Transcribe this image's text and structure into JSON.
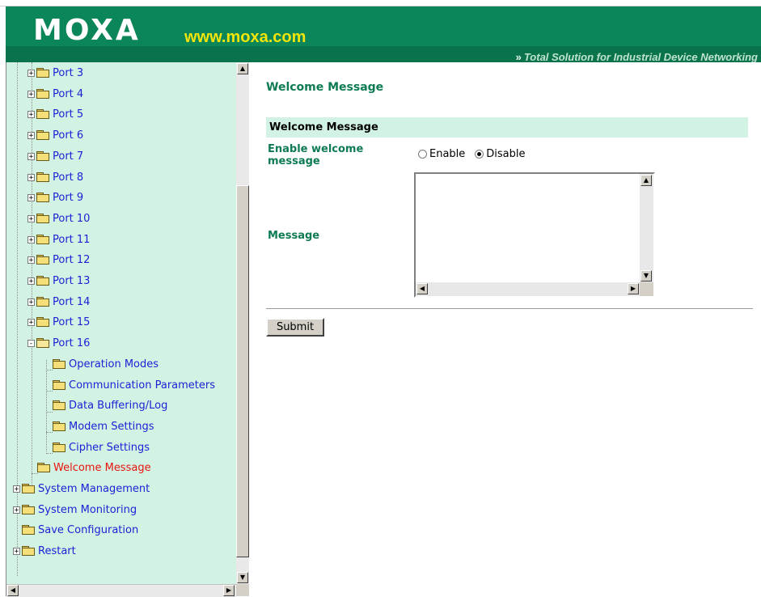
{
  "header": {
    "logo": "MOXA",
    "site": "www.moxa.com",
    "tagline": "Total Solution for Industrial Device Networking",
    "tagline_arrow": "»"
  },
  "sidebar": {
    "items": [
      {
        "label": "Port 3",
        "level": 1,
        "expand": "+",
        "current": false
      },
      {
        "label": "Port 4",
        "level": 1,
        "expand": "+",
        "current": false
      },
      {
        "label": "Port 5",
        "level": 1,
        "expand": "+",
        "current": false
      },
      {
        "label": "Port 6",
        "level": 1,
        "expand": "+",
        "current": false
      },
      {
        "label": "Port 7",
        "level": 1,
        "expand": "+",
        "current": false
      },
      {
        "label": "Port 8",
        "level": 1,
        "expand": "+",
        "current": false
      },
      {
        "label": "Port 9",
        "level": 1,
        "expand": "+",
        "current": false
      },
      {
        "label": "Port 10",
        "level": 1,
        "expand": "+",
        "current": false
      },
      {
        "label": "Port 11",
        "level": 1,
        "expand": "+",
        "current": false
      },
      {
        "label": "Port 12",
        "level": 1,
        "expand": "+",
        "current": false
      },
      {
        "label": "Port 13",
        "level": 1,
        "expand": "+",
        "current": false
      },
      {
        "label": "Port 14",
        "level": 1,
        "expand": "+",
        "current": false
      },
      {
        "label": "Port 15",
        "level": 1,
        "expand": "+",
        "current": false
      },
      {
        "label": "Port 16",
        "level": 1,
        "expand": "-",
        "current": false,
        "open": true
      },
      {
        "label": "Operation Modes",
        "level": 2,
        "expand": "",
        "current": false
      },
      {
        "label": "Communication Parameters",
        "level": 2,
        "expand": "",
        "current": false
      },
      {
        "label": "Data Buffering/Log",
        "level": 2,
        "expand": "",
        "current": false
      },
      {
        "label": "Modem Settings",
        "level": 2,
        "expand": "",
        "current": false
      },
      {
        "label": "Cipher Settings",
        "level": 2,
        "expand": "",
        "current": false
      },
      {
        "label": "Welcome Message",
        "level": 1,
        "expand": "",
        "current": true
      },
      {
        "label": "System Management",
        "level": 0,
        "expand": "+",
        "current": false
      },
      {
        "label": "System Monitoring",
        "level": 0,
        "expand": "+",
        "current": false
      },
      {
        "label": "Save Configuration",
        "level": 0,
        "expand": "",
        "current": false
      },
      {
        "label": "Restart",
        "level": 0,
        "expand": "+",
        "current": false
      }
    ]
  },
  "main": {
    "title": "Welcome Message",
    "section_header": "Welcome Message",
    "enable_label": "Enable welcome message",
    "enable_options": [
      "Enable",
      "Disable"
    ],
    "enable_selected": "Disable",
    "message_label": "Message",
    "message_value": "",
    "submit_label": "Submit"
  },
  "colors": {
    "header_green": "#0b8658",
    "site_yellow": "#f3e50a",
    "nav_bg": "#d2f3e3",
    "label_green": "#0e7b52",
    "link_blue": "#1b23d6",
    "current_red": "#e8140e"
  }
}
